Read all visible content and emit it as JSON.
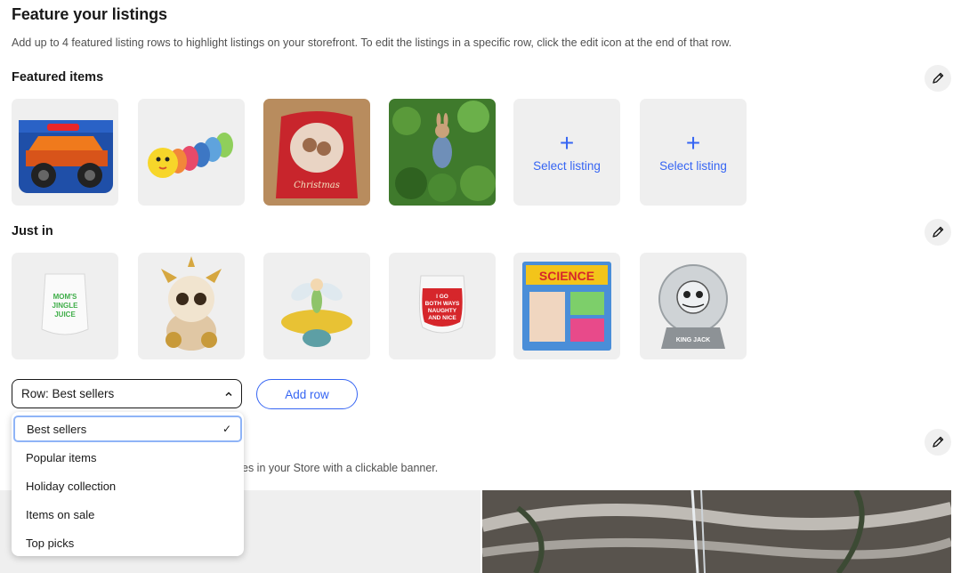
{
  "page": {
    "title": "Feature your listings",
    "description": "Add up to 4 featured listing rows to highlight listings on your storefront. To edit the listings in a specific row, click the edit icon at the end of that row."
  },
  "featured": {
    "title": "Featured items",
    "edit_icon": "pencil-icon",
    "items": [
      "monster-truck-toy",
      "caterpillar-plush",
      "christmas-wishes-sack",
      "rabbit-garden-figurine"
    ],
    "select_label": "Select listing"
  },
  "just_in": {
    "title": "Just in",
    "edit_icon": "pencil-icon",
    "items": [
      "moms-jingle-juice-glass",
      "unicorn-plush",
      "tinkerbell-figurine",
      "naughty-and-nice-glass",
      "amazing-science-kit",
      "jack-snow-globe"
    ],
    "glass1_text": "MOM'S\nJINGLE\nJUICE",
    "glass2_text": "I GO\nBOTH WAYS\nNAUGHTY\nAND NICE",
    "science_text": "SCIENCE",
    "globe_text": "KING JACK"
  },
  "controls": {
    "row_select_value": "Row: Best sellers",
    "add_row_label": "Add row"
  },
  "dropdown": {
    "options": [
      "Best sellers",
      "Popular items",
      "Holiday collection",
      "Items on sale",
      "Top picks"
    ],
    "selected": "Best sellers"
  },
  "banner": {
    "description_fragment": "es in your Store with a clickable banner.",
    "edit_icon": "pencil-icon"
  },
  "colors": {
    "accent": "#3665f3",
    "tile_bg": "#efefef",
    "text": "#191919"
  }
}
